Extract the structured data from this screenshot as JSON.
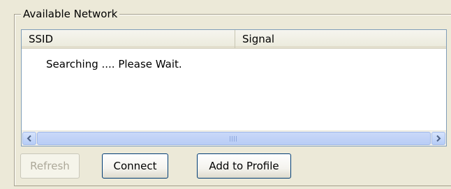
{
  "group": {
    "title": "Available Network"
  },
  "list": {
    "columns": [
      "SSID",
      "Signal"
    ],
    "rows": [
      {
        "text": "Searching .... Please Wait."
      }
    ],
    "scrollbar": {
      "left_arrow": "<",
      "right_arrow": ">",
      "grip": "III"
    }
  },
  "buttons": {
    "refresh": "Refresh",
    "connect": "Connect",
    "add_to_profile": "Add to Profile"
  },
  "colors": {
    "window_bg": "#ece9d8",
    "button_border": "#003c74",
    "disabled_text": "#aca899",
    "scrollbar_blue": "#b9cdf6"
  }
}
